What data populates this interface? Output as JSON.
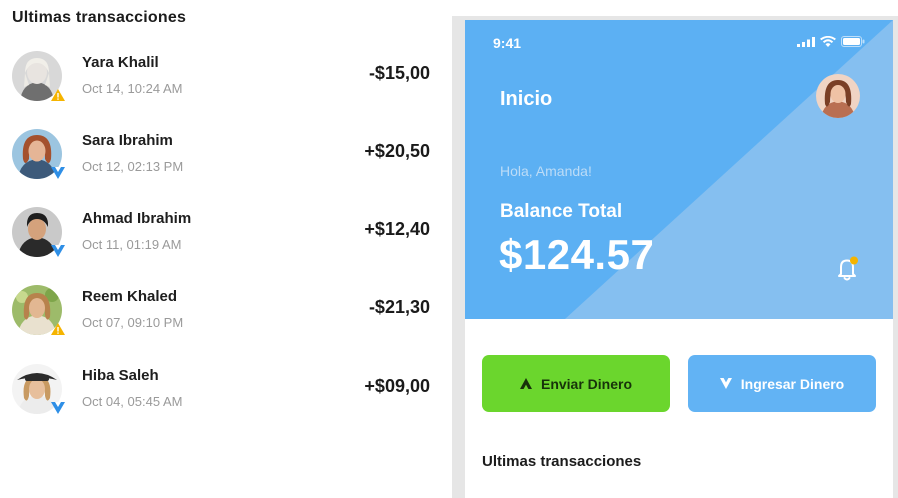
{
  "colors": {
    "accent_blue": "#62b3f4",
    "hero_blue": "#5cb0f3",
    "hero_light_blue": "#85bff0",
    "send_green": "#6bd62d",
    "warning_yellow": "#f5b400",
    "incoming_blue": "#2f8fe6"
  },
  "left_panel": {
    "title": "Ultimas transacciones",
    "transactions": [
      {
        "name": "Yara Khalil",
        "date": "Oct 14, 10:24 AM",
        "amount": "-$15,00",
        "direction": "warning-icon"
      },
      {
        "name": "Sara Ibrahim",
        "date": "Oct 12, 02:13 PM",
        "amount": "+$20,50",
        "direction": "incoming-arrow-icon"
      },
      {
        "name": "Ahmad Ibrahim",
        "date": "Oct 11, 01:19 AM",
        "amount": "+$12,40",
        "direction": "incoming-arrow-icon"
      },
      {
        "name": "Reem Khaled",
        "date": "Oct 07, 09:10 PM",
        "amount": "-$21,30",
        "direction": "warning-icon"
      },
      {
        "name": "Hiba Saleh",
        "date": "Oct 04, 05:45 AM",
        "amount": "+$09,00",
        "direction": "incoming-arrow-icon"
      }
    ]
  },
  "phone": {
    "status_time": "9:41",
    "status_icons": [
      "signal-icon",
      "wifi-icon",
      "battery-icon"
    ],
    "title": "Inicio",
    "greeting": "Hola, Amanda!",
    "balance_label": "Balance Total",
    "balance_amount": "$124.57",
    "notification_icon": "bell-icon",
    "send_button": "Enviar Dinero",
    "receive_button": "Ingresar Dinero",
    "bottom_title": "Ultimas transacciones"
  }
}
